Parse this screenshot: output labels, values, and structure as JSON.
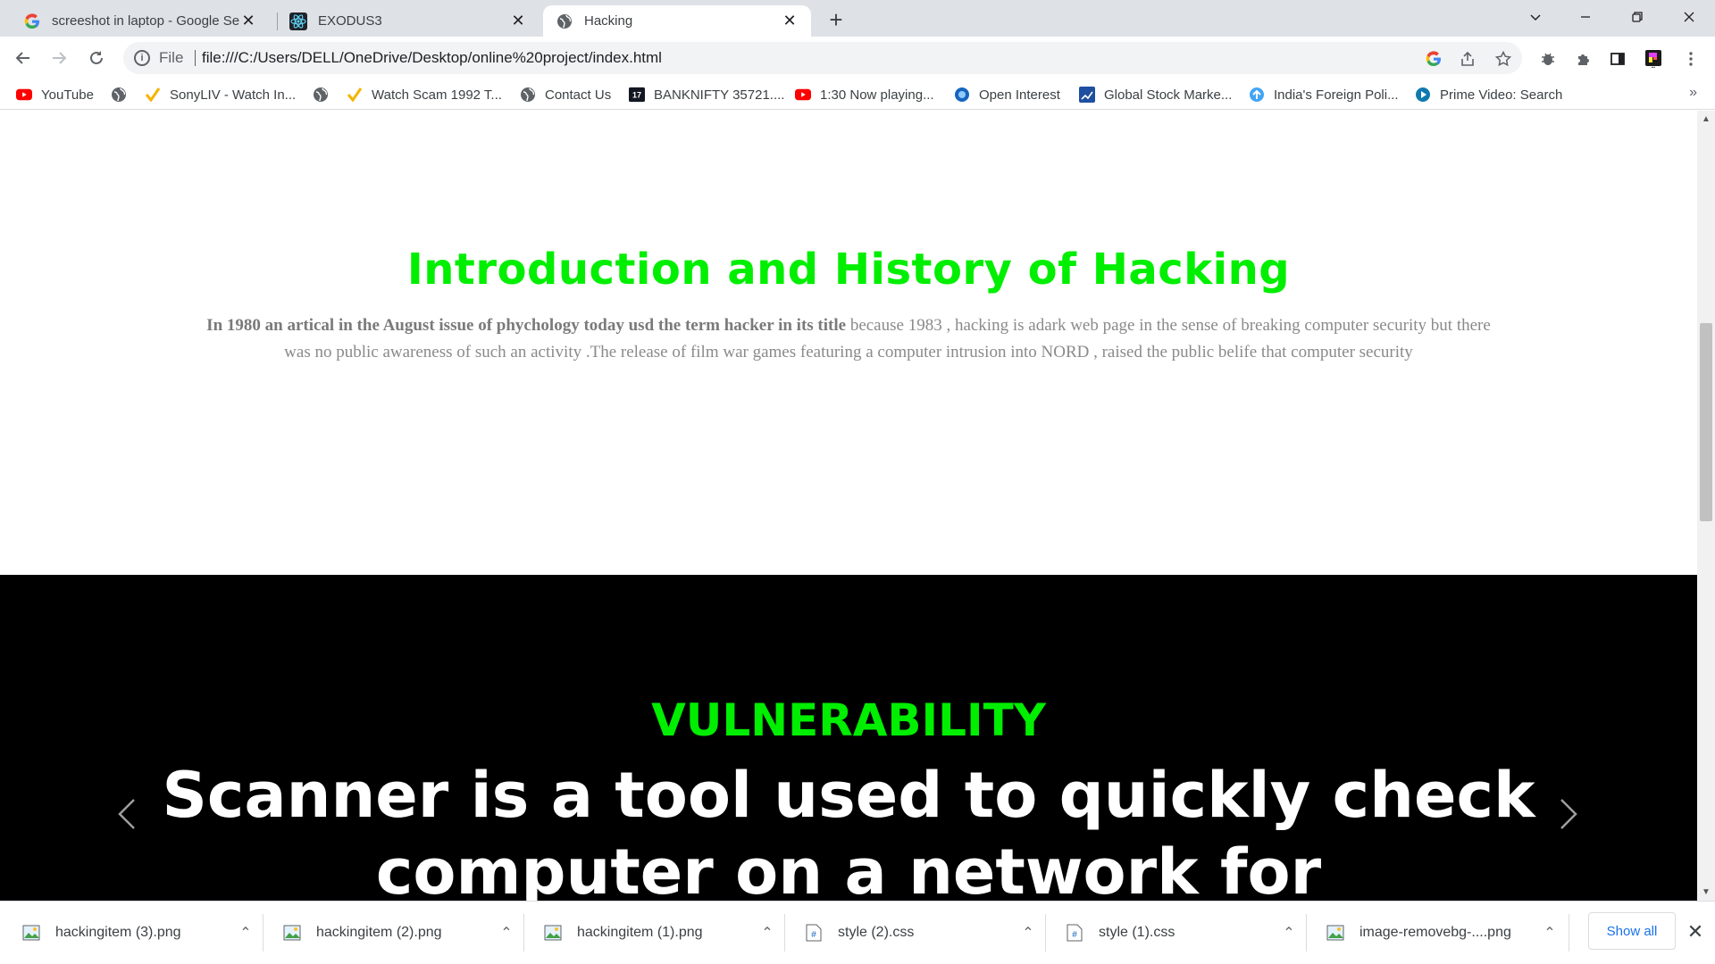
{
  "tabs": [
    {
      "title": "screeshot in laptop - Google Sea",
      "icon": "google-g-icon"
    },
    {
      "title": "EXODUS3",
      "icon": "react-atom-icon"
    },
    {
      "title": "Hacking",
      "icon": "globe-icon",
      "active": true
    }
  ],
  "address": {
    "scheme_label": "File",
    "url": "file:///C:/Users/DELL/OneDrive/Desktop/online%20project/index.html"
  },
  "bookmarks": [
    {
      "label": "YouTube",
      "icon": "youtube-icon"
    },
    {
      "label": "",
      "icon": "globe-icon"
    },
    {
      "label": "SonyLIV - Watch In...",
      "icon": "sonyliv-check-icon"
    },
    {
      "label": "",
      "icon": "globe-icon"
    },
    {
      "label": "Watch Scam 1992 T...",
      "icon": "sonyliv-check-icon"
    },
    {
      "label": "Contact Us",
      "icon": "globe-icon"
    },
    {
      "label": "BANKNIFTY 35721....",
      "icon": "tradingview-icon"
    },
    {
      "label": "1:30 Now playing...",
      "icon": "youtube-icon"
    },
    {
      "label": "Open Interest",
      "icon": "open-interest-icon"
    },
    {
      "label": "Global Stock Marke...",
      "icon": "stock-chart-icon"
    },
    {
      "label": "India's Foreign Poli...",
      "icon": "upload-arrow-icon"
    },
    {
      "label": "Prime Video: Search",
      "icon": "prime-video-icon"
    }
  ],
  "page": {
    "intro_title": "Introduction and History of Hacking",
    "intro_bold": "In 1980 an artical in the August issue of phychology today usd the term hacker in its title",
    "intro_text": " because 1983 , hacking is adark web page in the sense of breaking computer security but there was no public awareness of such an activity .The release of film war games featuring a computer intrusion into NORD , raised the public belife that computer security",
    "vuln_title": "VULNERABILITY",
    "vuln_text": "Scanner is a tool used to quickly check computer on a network for"
  },
  "downloads": [
    {
      "name": "hackingitem (3).png",
      "icon": "image-file-icon"
    },
    {
      "name": "hackingitem (2).png",
      "icon": "image-file-icon"
    },
    {
      "name": "hackingitem (1).png",
      "icon": "image-file-icon"
    },
    {
      "name": "style (2).css",
      "icon": "css-file-icon"
    },
    {
      "name": "style (1).css",
      "icon": "css-file-icon"
    },
    {
      "name": "image-removebg-....png",
      "icon": "image-file-icon"
    }
  ],
  "shelf": {
    "show_all": "Show all"
  },
  "colors": {
    "accent_green": "#00ee00",
    "link_blue": "#1a73e8"
  }
}
